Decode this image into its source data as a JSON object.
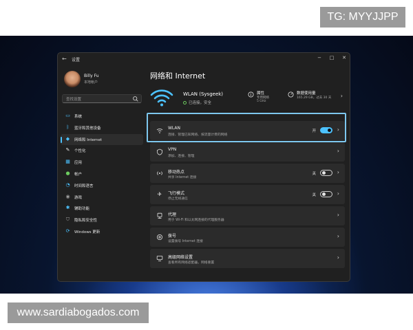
{
  "watermark_top": "TG: MYYJJPP",
  "watermark_bottom": "www.sardiabogados.com",
  "window": {
    "title": "设置",
    "back_glyph": "←",
    "minimize_glyph": "−",
    "maximize_glyph": "□",
    "close_glyph": "✕"
  },
  "user": {
    "name": "Billy Fu",
    "account": "本地帐户"
  },
  "search": {
    "placeholder": "查找设置"
  },
  "sidebar": {
    "items": [
      {
        "label": "系统",
        "icon": "monitor-icon",
        "color": "#4cc2ff"
      },
      {
        "label": "蓝牙和其他设备",
        "icon": "bluetooth-icon",
        "color": "#4cc2ff"
      },
      {
        "label": "网络和 Internet",
        "icon": "network-icon",
        "color": "#4cc2ff",
        "active": true
      },
      {
        "label": "个性化",
        "icon": "brush-icon",
        "color": "#e6e6e6"
      },
      {
        "label": "应用",
        "icon": "apps-icon",
        "color": "#4cc2ff"
      },
      {
        "label": "帐户",
        "icon": "person-icon",
        "color": "#6ccb5f"
      },
      {
        "label": "时间和语言",
        "icon": "globe-clock-icon",
        "color": "#4cc2ff"
      },
      {
        "label": "游戏",
        "icon": "gamepad-icon",
        "color": "#9e9e9e"
      },
      {
        "label": "辅助功能",
        "icon": "accessibility-icon",
        "color": "#4cc2ff"
      },
      {
        "label": "隐私和安全性",
        "icon": "shield-icon",
        "color": "#9e9e9e"
      },
      {
        "label": "Windows 更新",
        "icon": "update-icon",
        "color": "#4cc2ff"
      }
    ]
  },
  "main": {
    "title": "网络和 Internet",
    "hero": {
      "name": "WLAN (Sysgeek)",
      "status": "已连接，安全",
      "properties": {
        "title": "属性",
        "line1": "专用网络",
        "line2": "5 GHz"
      },
      "usage": {
        "title": "数据使用量",
        "line1": "165.29 GB，过去 30 天"
      }
    },
    "rows": [
      {
        "title": "WLAN",
        "subtitle": "连接、管理已知网络、按流量计费的网络",
        "icon": "wifi-icon",
        "state": "开",
        "toggle": "on"
      },
      {
        "title": "VPN",
        "subtitle": "添加、连接、管理",
        "icon": "shield-outline-icon",
        "state": "",
        "toggle": ""
      },
      {
        "title": "移动热点",
        "subtitle": "共享 Internet 连接",
        "icon": "hotspot-icon",
        "state": "关",
        "toggle": "off"
      },
      {
        "title": "飞行模式",
        "subtitle": "停止无线通信",
        "icon": "airplane-icon",
        "state": "关",
        "toggle": "off"
      },
      {
        "title": "代理",
        "subtitle": "用于 Wi-Fi 和以太网连接的代理服务器",
        "icon": "proxy-icon",
        "state": "",
        "toggle": ""
      },
      {
        "title": "拨号",
        "subtitle": "设置拨号 Internet 连接",
        "icon": "dialup-icon",
        "state": "",
        "toggle": ""
      },
      {
        "title": "高级网络设置",
        "subtitle": "查看所有网络适配器，网络重置",
        "icon": "advanced-network-icon",
        "state": "",
        "toggle": ""
      }
    ]
  },
  "colors": {
    "accent": "#4cc2ff",
    "highlight": "#7ec8ef",
    "connected": "#6ccb5f"
  }
}
